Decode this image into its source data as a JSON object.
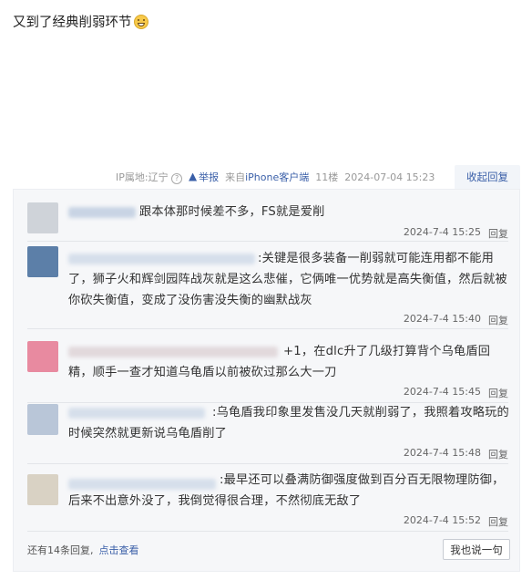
{
  "post": {
    "text": "又到了经典削弱环节"
  },
  "meta": {
    "ip": "IP属地:辽宁",
    "report": "举报",
    "source_prefix": "来自",
    "source_link": "iPhone客户端",
    "floor": "11楼",
    "datetime": "2024-07-04 15:23",
    "collapse": "收起回复"
  },
  "replies": [
    {
      "text": "跟本体那时候差不多，FS就是爱削",
      "time": "2024-7-4 15:25",
      "reply": "回复",
      "avatar_color": "#c9cdd3"
    },
    {
      "text": ":关键是很多装备一削弱就可能连用都不能用了，狮子火和辉剑园阵战灰就是这么悲催，它俩唯一优势就是高失衡值，然后就被你砍失衡值，变成了没伤害没失衡的幽默战灰",
      "time": "2024-7-4 15:40",
      "reply": "回复",
      "avatar_color": "#5c7fa8"
    },
    {
      "text": "+1，在dlc升了几级打算背个乌龟盾回精，顺手一查才知道乌龟盾以前被砍过那么大一刀",
      "time": "2024-7-4 15:45",
      "reply": "回复",
      "avatar_color": "#e88aa0"
    },
    {
      "text": ":乌龟盾我印象里发售没几天就削弱了，我照着攻略玩的时候突然就更新说乌龟盾削了",
      "time": "2024-7-4 15:48",
      "reply": "回复",
      "avatar_color": "#b9c6d8"
    },
    {
      "text": ":最早还可以叠满防御强度做到百分百无限物理防御，后来不出意外没了，我倒觉得很合理，不然彻底无敌了",
      "time": "2024-7-4 15:52",
      "reply": "回复",
      "avatar_color": "#d9d2c4"
    }
  ],
  "footer": {
    "more_prefix": "还有14条回复,",
    "more_link": "点击查看",
    "say_button": "我也说一句"
  }
}
